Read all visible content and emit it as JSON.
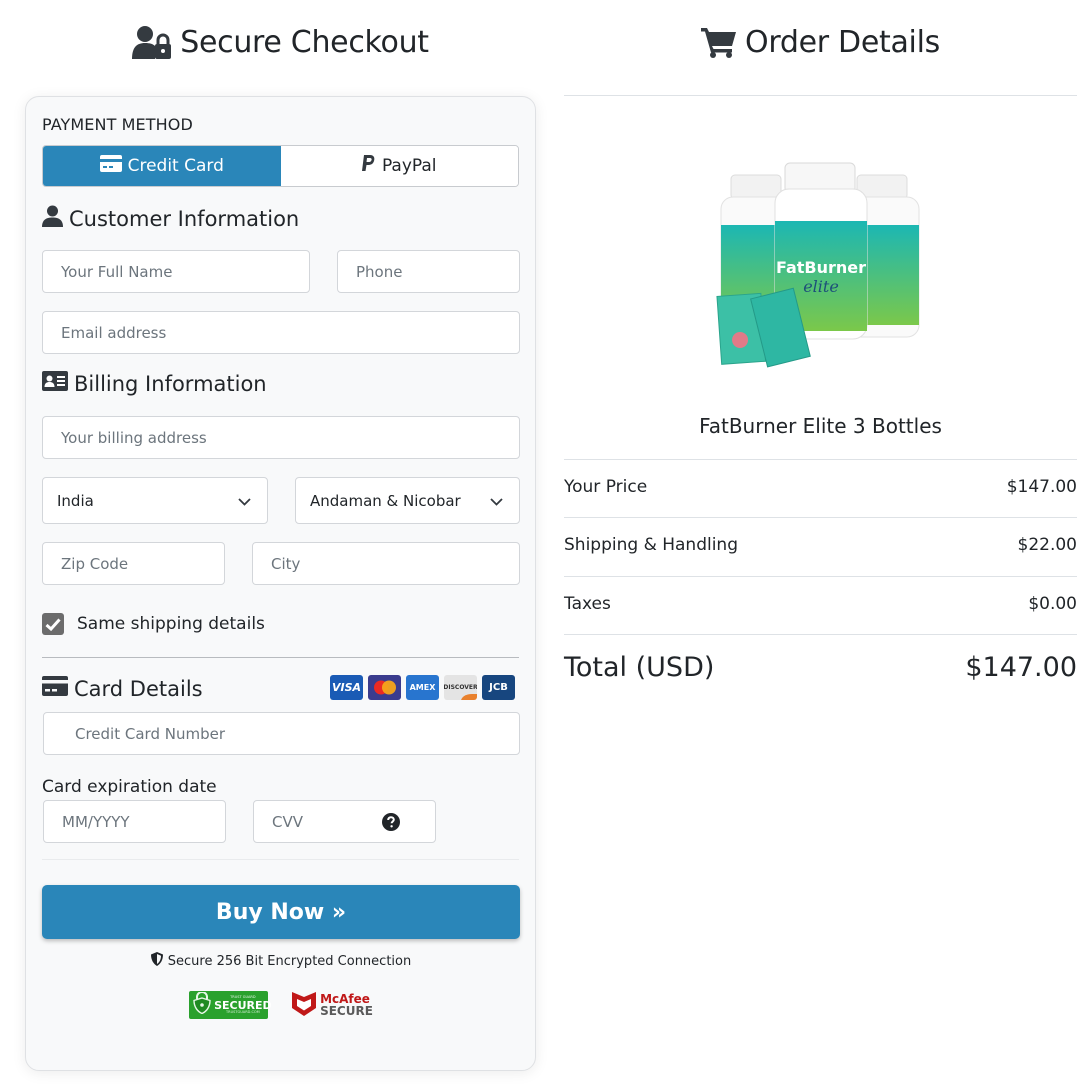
{
  "left_heading": {
    "title": "Secure Checkout",
    "icon": "user-lock-icon"
  },
  "right_heading": {
    "title": "Order Details",
    "icon": "shopping-cart-icon"
  },
  "payment": {
    "label": "PAYMENT METHOD",
    "options": [
      {
        "label": "Credit Card",
        "icon": "credit-card-icon",
        "active": true
      },
      {
        "label": "PayPal",
        "icon": "paypal-icon",
        "active": false
      }
    ]
  },
  "customer": {
    "title": "Customer Information",
    "full_name_placeholder": "Your Full Name",
    "phone_placeholder": "Phone",
    "email_placeholder": "Email address"
  },
  "billing": {
    "title": "Billing Information",
    "address_placeholder": "Your billing address",
    "country": "India",
    "state": "Andaman & Nicobar",
    "zip_placeholder": "Zip Code",
    "city_placeholder": "City",
    "same_shipping_label": "Same shipping details",
    "same_shipping_checked": true
  },
  "card": {
    "title": "Card Details",
    "logos": [
      "VISA",
      "MasterCard",
      "AMEX",
      "DISCOVER",
      "JCB"
    ],
    "number_placeholder": "Credit Card Number",
    "expiration_label": "Card expiration date",
    "expiry_placeholder": "MM/YYYY",
    "cvv_placeholder": "CVV"
  },
  "buy_button": "Buy Now »",
  "secure_note": "Secure 256 Bit Encrypted Connection",
  "badges": {
    "trust_top": "TRUST GUARD",
    "trust_main": "SECURED",
    "trust_bottom": "TRUSTGUARD.COM",
    "mcafee_top": "McAfee",
    "mcafee_bottom": "SECURE"
  },
  "order": {
    "product_image_alt": "FatBurner Elite bottles",
    "product_label_main": "FatBurner",
    "product_label_sub": "elite",
    "product_name": "FatBurner Elite 3 Bottles",
    "rows": [
      {
        "label": "Your Price",
        "value": "$147.00"
      },
      {
        "label": "Shipping & Handling",
        "value": "$22.00"
      },
      {
        "label": "Taxes",
        "value": "$0.00"
      }
    ],
    "total_label": "Total (USD)",
    "total_value": "$147.00"
  },
  "colors": {
    "primary": "#2a86b9",
    "trust_green": "#2aa12d",
    "mcafee_red": "#c01818"
  }
}
